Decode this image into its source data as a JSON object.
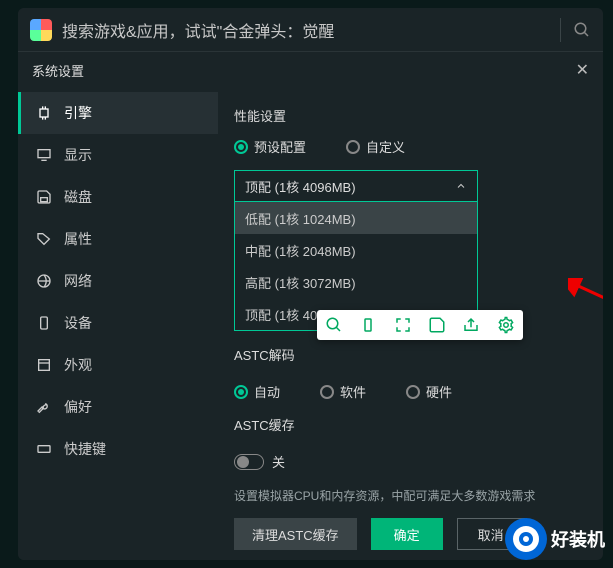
{
  "topbar": {
    "search_placeholder": "搜索游戏&应用，试试\"合金弹头：觉醒"
  },
  "header": {
    "title": "系统设置"
  },
  "sidebar": {
    "items": [
      {
        "label": "引擎",
        "icon": "cpu-icon"
      },
      {
        "label": "显示",
        "icon": "monitor-icon"
      },
      {
        "label": "磁盘",
        "icon": "save-icon"
      },
      {
        "label": "属性",
        "icon": "tag-icon"
      },
      {
        "label": "网络",
        "icon": "globe-icon"
      },
      {
        "label": "设备",
        "icon": "phone-icon"
      },
      {
        "label": "外观",
        "icon": "window-icon"
      },
      {
        "label": "偏好",
        "icon": "wrench-icon"
      },
      {
        "label": "快捷键",
        "icon": "keyboard-icon"
      }
    ]
  },
  "main": {
    "perf_title": "性能设置",
    "radio_preset": "预设配置",
    "radio_custom": "自定义",
    "select_value": "顶配 (1核 4096MB)",
    "options": [
      {
        "label": "低配 (1核 1024MB)"
      },
      {
        "label": "中配 (1核 2048MB)"
      },
      {
        "label": "高配 (1核 3072MB)"
      },
      {
        "label": "顶配 (1核 4096MB)"
      }
    ],
    "astc_decode": "ASTC解码",
    "astc_auto": "自动",
    "astc_soft": "软件",
    "astc_hard": "硬件",
    "astc_cache": "ASTC缓存",
    "cache_off": "关",
    "hint": "设置模拟器CPU和内存资源，中配可满足大多数游戏需求",
    "btn_clear": "清理ASTC缓存",
    "btn_ok": "确定",
    "btn_cancel": "取消"
  },
  "watermark": {
    "text": "好装机"
  }
}
